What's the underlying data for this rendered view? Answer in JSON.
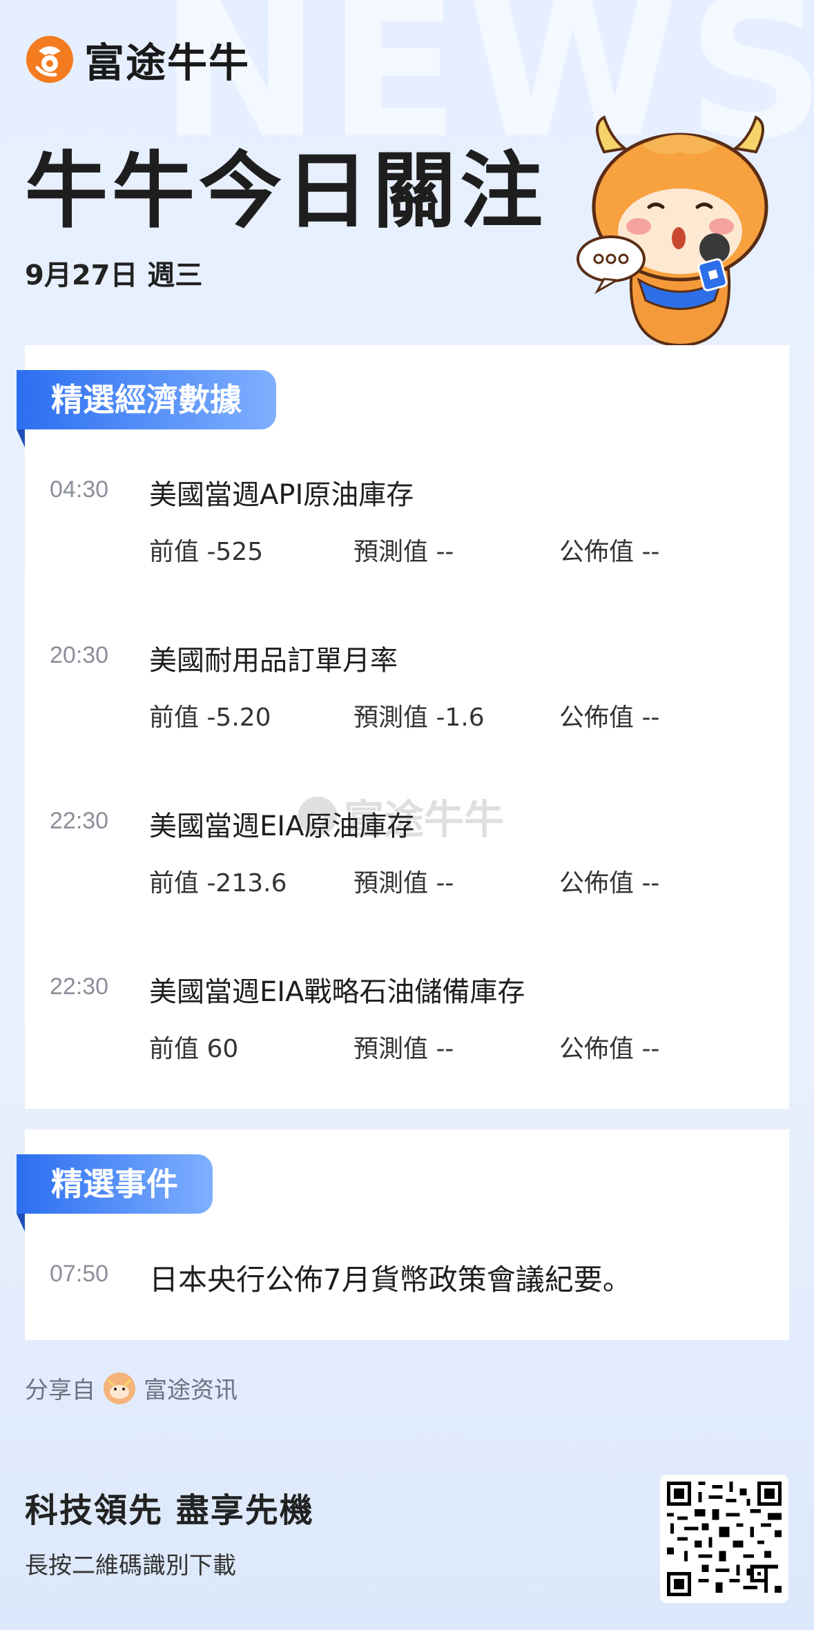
{
  "background_word": "NEWS",
  "brand": {
    "name": "富途牛牛"
  },
  "header": {
    "title": "牛牛今日關注",
    "date": "9月27日 週三"
  },
  "econ_section": {
    "tab_label": "精選經濟數據",
    "rows": [
      {
        "time": "04:30",
        "title": "美國當週API原油庫存",
        "prev": "前值 -525",
        "forecast": "預測值 --",
        "actual": "公佈值 --"
      },
      {
        "time": "20:30",
        "title": "美國耐用品訂單月率",
        "prev": "前值 -5.20",
        "forecast": "預測值 -1.6",
        "actual": "公佈值 --"
      },
      {
        "time": "22:30",
        "title": "美國當週EIA原油庫存",
        "prev": "前值 -213.6",
        "forecast": "預測值 --",
        "actual": "公佈值 --"
      },
      {
        "time": "22:30",
        "title": "美國當週EIA戰略石油儲備庫存",
        "prev": "前值 60",
        "forecast": "預測值 --",
        "actual": "公佈值 --"
      }
    ]
  },
  "watermark": {
    "text": "富途牛牛"
  },
  "events_section": {
    "tab_label": "精選事件",
    "rows": [
      {
        "time": "07:50",
        "title": "日本央行公佈7月貨幣政策會議紀要。"
      }
    ]
  },
  "footer": {
    "share_prefix": "分享自",
    "share_source": "富途资讯",
    "slogan": "科技領先 盡享先機",
    "download_hint": "長按二維碼識別下載"
  },
  "icons": {
    "brand_logo": "futu-logo-icon",
    "mascot": "bull-mascot-icon",
    "qr": "qr-code-icon",
    "avatar": "avatar-icon"
  },
  "colors": {
    "brand_orange": "#f47b20",
    "tab_blue_start": "#2b6ef0",
    "tab_blue_end": "#7fb0ff"
  }
}
